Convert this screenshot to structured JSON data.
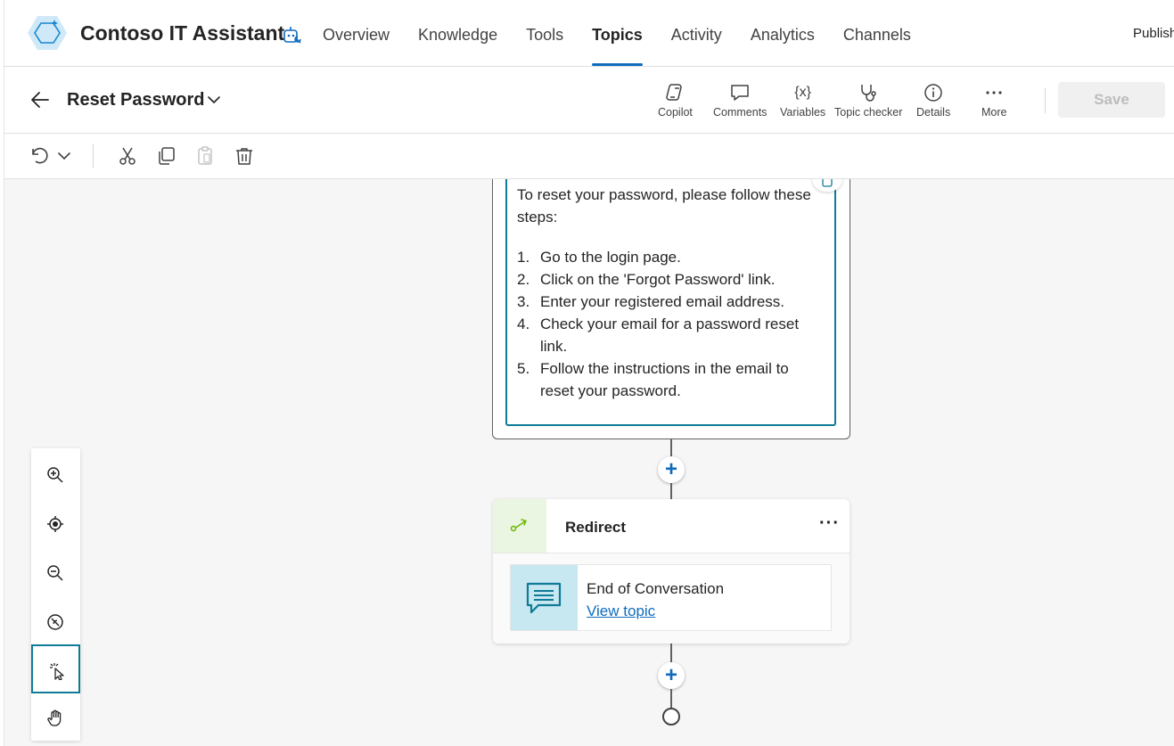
{
  "app": {
    "title": "Contoso IT Assistant",
    "publish_label": "Publish"
  },
  "nav": {
    "overview": "Overview",
    "knowledge": "Knowledge",
    "tools": "Tools",
    "topics": "Topics",
    "activity": "Activity",
    "analytics": "Analytics",
    "channels": "Channels",
    "active": "Topics"
  },
  "topic": {
    "title": "Reset Password"
  },
  "toolbar": {
    "copilot": "Copilot",
    "comments": "Comments",
    "variables": "Variables",
    "variables_glyph": "{x}",
    "topic_checker": "Topic checker",
    "details": "Details",
    "more": "More",
    "save": "Save"
  },
  "message": {
    "intro": "To reset your password, please follow these steps:",
    "steps": [
      {
        "num": "1.",
        "text": "Go to the login page."
      },
      {
        "num": "2.",
        "text": "Click on the 'Forgot Password' link."
      },
      {
        "num": "3.",
        "text": "Enter your registered email address."
      },
      {
        "num": "4.",
        "text": "Check your email for a password reset link."
      },
      {
        "num": "5.",
        "text": "Follow the instructions in the email to reset your password."
      }
    ]
  },
  "redirect": {
    "title": "Redirect",
    "more_glyph": "···",
    "target_topic": "End of Conversation",
    "view_link": "View topic"
  },
  "canvas": {
    "add_glyph": "+"
  },
  "colors": {
    "accent": "#0f6cbd",
    "teal_border": "#0f7b96",
    "redirect_green": "#6bb700",
    "tile_blue": "#c7e7f1"
  }
}
